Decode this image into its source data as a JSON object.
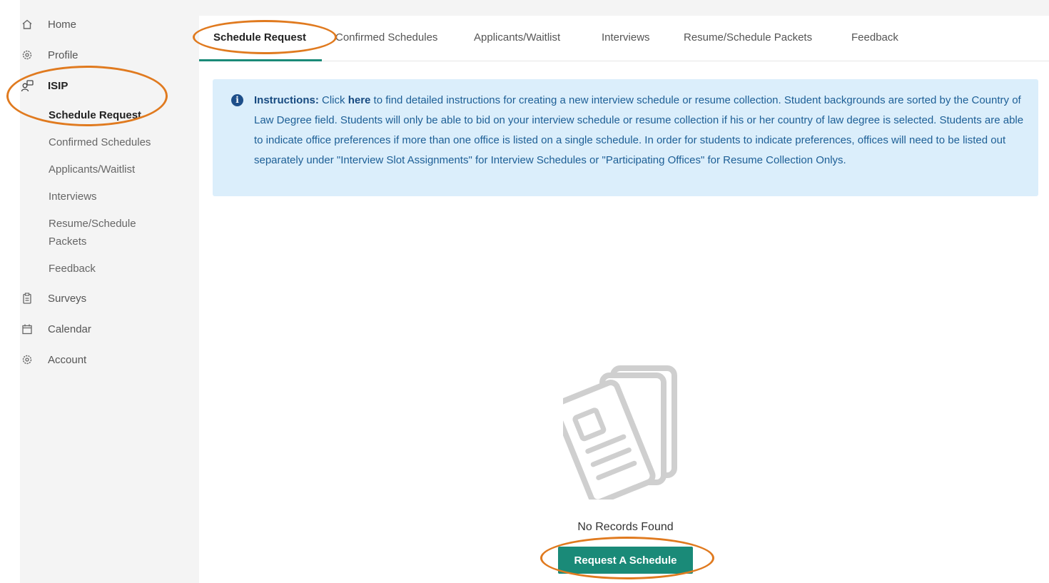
{
  "sidebar": {
    "home": "Home",
    "profile": "Profile",
    "isip": "ISIP",
    "isip_items": [
      "Schedule Request",
      "Confirmed Schedules",
      "Applicants/Waitlist",
      "Interviews",
      "Resume/Schedule Packets",
      "Feedback"
    ],
    "surveys": "Surveys",
    "calendar": "Calendar",
    "account": "Account"
  },
  "tabs": [
    "Schedule Request",
    "Confirmed Schedules",
    "Applicants/Waitlist",
    "Interviews",
    "Resume/Schedule Packets",
    "Feedback"
  ],
  "instructions": {
    "label": "Instructions:",
    "text_before_link": " Click ",
    "link": "here",
    "text_after_link": " to find detailed instructions for creating a new interview schedule or resume collection. Student backgrounds are sorted by the Country of Law Degree field. Students will only be able to bid on your interview schedule or resume collection if his or her country of law degree is selected. Students are able to indicate office preferences if more than one office is listed on a single schedule. In order for students to indicate preferences, offices will need to be listed out separately under \"Interview Slot Assignments\" for Interview Schedules or \"Participating Offices\" for Resume Collection Onlys."
  },
  "empty_state": {
    "message": "No Records Found",
    "button": "Request A Schedule"
  },
  "colors": {
    "accent": "#1a8a78",
    "highlight": "#e07a1f",
    "info_bg": "#dbeefb"
  }
}
